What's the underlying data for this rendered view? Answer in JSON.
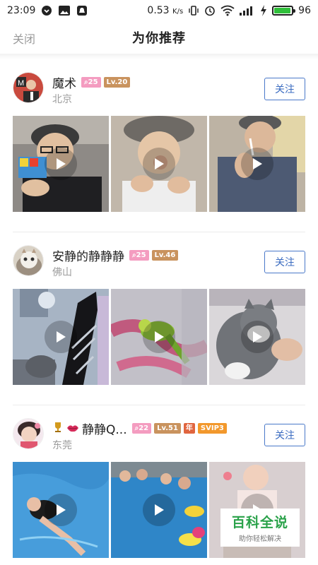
{
  "status_bar": {
    "time": "23:09",
    "speed": "0.53",
    "speed_unit": "K/s",
    "battery": "96",
    "battery_level": 0.96,
    "battery_color": "#2fbf3a"
  },
  "header": {
    "close_label": "关闭",
    "title": "为你推荐"
  },
  "follow_label": "关注",
  "users": [
    {
      "name": "魔术",
      "fans": "25",
      "level": "Lv.20",
      "location": "北京",
      "videos": 3
    },
    {
      "name": "安静的静静静",
      "fans": "25",
      "level": "Lv.46",
      "location": "佛山",
      "videos": 3
    },
    {
      "name": "静静Q...",
      "fans": "22",
      "level": "Lv.51",
      "year": "年",
      "svip": "SVIP3",
      "location": "东莞",
      "videos": 3
    }
  ],
  "watermark": {
    "title": "百科全说",
    "subtitle": "助你轻松解决"
  },
  "colors": {
    "accent": "#3a6bc0",
    "fans_badge": "#f49cc0",
    "level_badge": "#c9935e",
    "svip_badge": "#f2982c"
  }
}
